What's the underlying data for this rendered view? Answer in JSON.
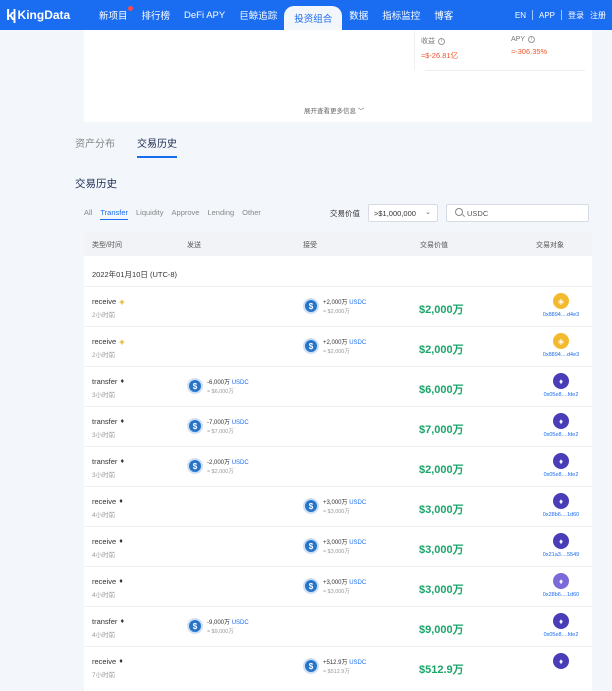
{
  "nav": {
    "logo": "KingData",
    "items": [
      "新项目",
      "排行榜",
      "DeFi APY",
      "巨鲸追踪",
      "投资组合",
      "数据",
      "指标监控",
      "博客"
    ],
    "active_index": 4,
    "lang": "EN",
    "app": "APP",
    "login": "登录",
    "register": "注册"
  },
  "summary": {
    "profit_label": "收益",
    "profit_value": "≈$-26.81亿",
    "apy_label": "APY",
    "apy_value": "≈-306.35%",
    "expand_label": "展开查看更多信息"
  },
  "tabs": [
    "资产分布",
    "交易历史"
  ],
  "active_tab": 1,
  "section_title": "交易历史",
  "filters": [
    "All",
    "Transfer",
    "Liquidity",
    "Approve",
    "Lending",
    "Other"
  ],
  "active_filter": 1,
  "value_filter": {
    "label": "交易价值",
    "selected": ">$1,000,000"
  },
  "search": {
    "value": "USDC"
  },
  "table": {
    "headers": [
      "类型/时间",
      "发送",
      "接受",
      "交易价值",
      "交易对象"
    ],
    "date_group": "2022年01月10日 (UTC-8)",
    "rows": [
      {
        "type": "receive",
        "chain": "bnb",
        "time": "2小时前",
        "send": null,
        "recv": {
          "amt": "+2,000万",
          "sym": "USDC",
          "usd": "≈ $2,000万"
        },
        "value": "$2,000万",
        "cp_icon": "bnb",
        "cp_addr": "0x8894....d4e3"
      },
      {
        "type": "receive",
        "chain": "bnb",
        "time": "2小时前",
        "send": null,
        "recv": {
          "amt": "+2,000万",
          "sym": "USDC",
          "usd": "≈ $2,000万"
        },
        "value": "$2,000万",
        "cp_icon": "bnb",
        "cp_addr": "0x8894....d4e3"
      },
      {
        "type": "transfer",
        "chain": "eth",
        "time": "3小时前",
        "send": {
          "amt": "-6,000万",
          "sym": "USDC",
          "usd": "≈ $6,000万"
        },
        "recv": null,
        "value": "$6,000万",
        "cp_icon": "eth",
        "cp_addr": "0x05e8....fde2"
      },
      {
        "type": "transfer",
        "chain": "eth",
        "time": "3小时前",
        "send": {
          "amt": "-7,000万",
          "sym": "USDC",
          "usd": "≈ $7,000万"
        },
        "recv": null,
        "value": "$7,000万",
        "cp_icon": "eth",
        "cp_addr": "0x05e8....fde2"
      },
      {
        "type": "transfer",
        "chain": "eth",
        "time": "3小时前",
        "send": {
          "amt": "-2,000万",
          "sym": "USDC",
          "usd": "≈ $2,000万"
        },
        "recv": null,
        "value": "$2,000万",
        "cp_icon": "eth",
        "cp_addr": "0x05e8....fde2"
      },
      {
        "type": "receive",
        "chain": "eth",
        "time": "4小时前",
        "send": null,
        "recv": {
          "amt": "+3,000万",
          "sym": "USDC",
          "usd": "≈ $3,000万"
        },
        "value": "$3,000万",
        "cp_icon": "eth",
        "cp_addr": "0x28b6....1d60"
      },
      {
        "type": "receive",
        "chain": "eth",
        "time": "4小时前",
        "send": null,
        "recv": {
          "amt": "+3,000万",
          "sym": "USDC",
          "usd": "≈ $3,000万"
        },
        "value": "$3,000万",
        "cp_icon": "eth",
        "cp_addr": "0x21a3....5549"
      },
      {
        "type": "receive",
        "chain": "eth",
        "time": "4小时前",
        "send": null,
        "recv": {
          "amt": "+3,000万",
          "sym": "USDC",
          "usd": "≈ $3,000万"
        },
        "value": "$3,000万",
        "cp_icon": "eth2",
        "cp_addr": "0x28b6....1d60"
      },
      {
        "type": "transfer",
        "chain": "eth",
        "time": "4小时前",
        "send": {
          "amt": "-9,000万",
          "sym": "USDC",
          "usd": "≈ $9,000万"
        },
        "recv": null,
        "value": "$9,000万",
        "cp_icon": "eth",
        "cp_addr": "0x05e8....fde2"
      },
      {
        "type": "receive",
        "chain": "eth",
        "time": "7小时前",
        "send": null,
        "recv": {
          "amt": "+512.9万",
          "sym": "USDC",
          "usd": "≈ $512.9万"
        },
        "value": "$512.9万",
        "cp_icon": "eth",
        "cp_addr": ""
      }
    ]
  }
}
